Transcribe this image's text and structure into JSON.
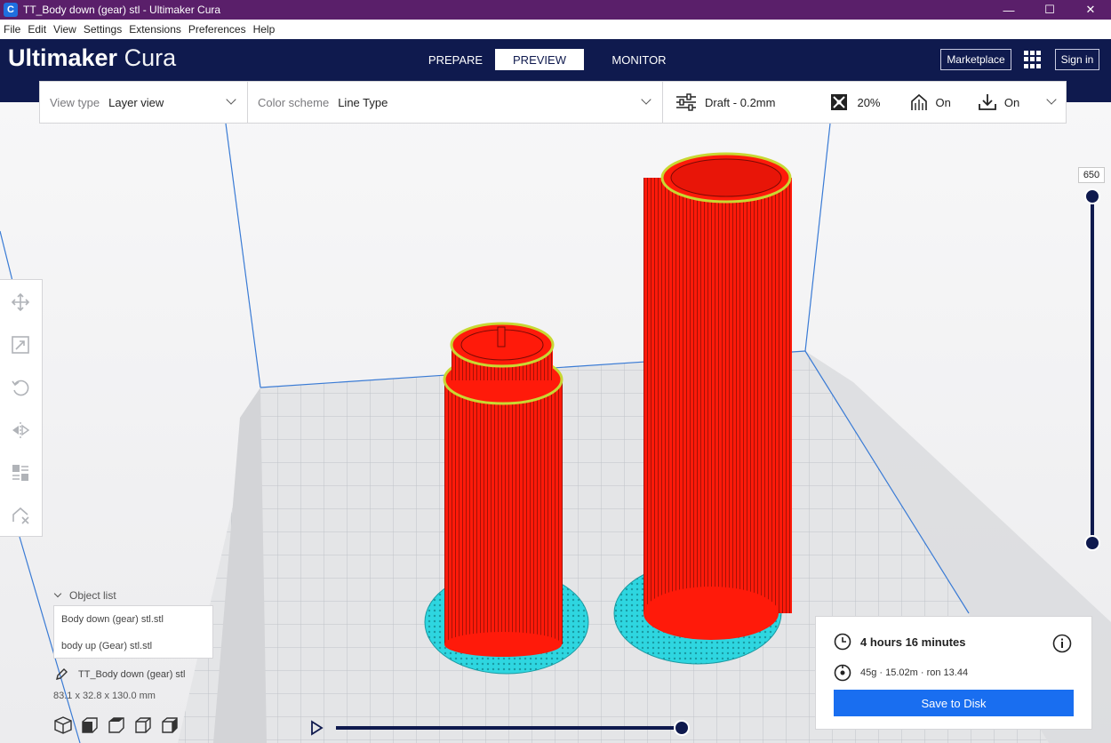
{
  "window": {
    "title": "TT_Body down (gear) stl - Ultimaker Cura",
    "app_icon_letter": "C",
    "minimize": "—",
    "maximize": "☐",
    "close": "✕"
  },
  "menu": [
    "File",
    "Edit",
    "View",
    "Settings",
    "Extensions",
    "Preferences",
    "Help"
  ],
  "header": {
    "brand_bold": "Ultimaker",
    "brand_light": "Cura",
    "stages": [
      {
        "label": "PREPARE",
        "active": false
      },
      {
        "label": "PREVIEW",
        "active": true
      },
      {
        "label": "MONITOR",
        "active": false
      }
    ],
    "marketplace": "Marketplace",
    "apps_icon": "grid-icon",
    "sign_in": "Sign in"
  },
  "toolbar": {
    "view_type_label": "View type",
    "view_type_value": "Layer view",
    "color_scheme_label": "Color scheme",
    "color_scheme_value": "Line Type",
    "profile": "Draft - 0.2mm",
    "infill": "20%",
    "support": "On",
    "adhesion": "On"
  },
  "layer_slider": {
    "value": "650"
  },
  "left_tools": [
    "move-icon",
    "scale-icon",
    "rotate-icon",
    "mirror-icon",
    "per-model-settings-icon",
    "support-blocker-icon"
  ],
  "object_list": {
    "header": "Object list",
    "items": [
      "Body down (gear) stl.stl",
      "body up  (Gear) stl.stl"
    ],
    "selected": "TT_Body down (gear) stl",
    "dimensions": "83.1 x 32.8 x 130.0 mm"
  },
  "camera_views": [
    "3d-view-icon",
    "front-view-icon",
    "top-view-icon",
    "left-view-icon",
    "right-view-icon"
  ],
  "print_info": {
    "time": "4 hours 16 minutes",
    "material": "45g · 15.02m · ron 13.44",
    "save_button": "Save to Disk"
  },
  "colors": {
    "header_bg": "#0f1a4e",
    "title_bar": "#5a1f6a",
    "accent_blue": "#196ef0",
    "wall_red": "#ff1a0a",
    "skirt_cyan": "#2ed6e0",
    "top_yellow": "#d8e040"
  }
}
